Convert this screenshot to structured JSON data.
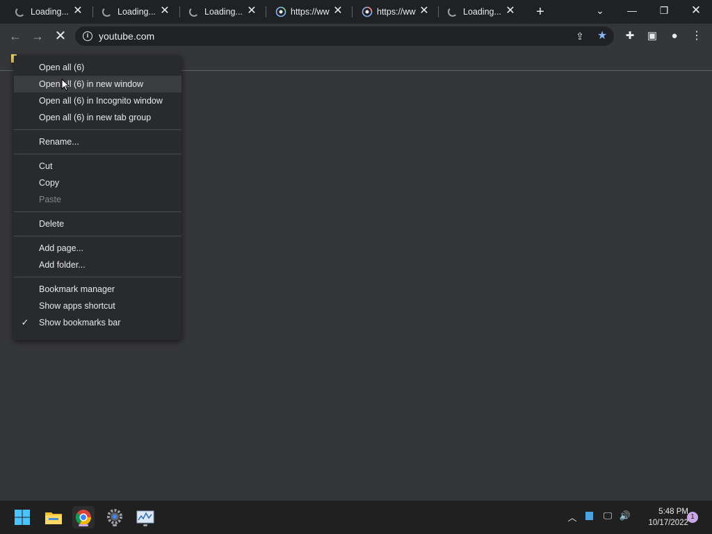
{
  "browser": {
    "tabs": [
      {
        "label": "Loading...",
        "kind": "spinner"
      },
      {
        "label": "Loading...",
        "kind": "spinner"
      },
      {
        "label": "Loading...",
        "kind": "spinner"
      },
      {
        "label": "https://www.google.com",
        "kind": "globe"
      },
      {
        "label": "https://www.google.com",
        "kind": "globe"
      },
      {
        "label": "Loading...",
        "kind": "spinner"
      }
    ],
    "new_tab_label": "+",
    "url": "youtube.com"
  },
  "context_menu": {
    "items": [
      {
        "label": "Open all (6)"
      },
      {
        "label": "Open all (6) in new window",
        "highlighted": true
      },
      {
        "label": "Open all (6) in Incognito window"
      },
      {
        "label": "Open all (6) in new tab group"
      },
      {
        "label": "Rename..."
      },
      {
        "label": "Cut"
      },
      {
        "label": "Copy"
      },
      {
        "label": "Paste",
        "disabled": true
      },
      {
        "label": "Delete"
      },
      {
        "label": "Add page..."
      },
      {
        "label": "Add folder..."
      },
      {
        "label": "Bookmark manager"
      },
      {
        "label": "Show apps shortcut"
      },
      {
        "label": "Show bookmarks bar",
        "checked": true
      }
    ]
  },
  "taskbar": {
    "time": "5:48 PM",
    "date": "10/17/2022",
    "notification_count": "1"
  },
  "colors": {
    "background": "#35363a",
    "titlebar": "#202124",
    "menu": "#292a2d",
    "accent_blue": "#8ab4f8",
    "folder_yellow": "#f4d469"
  }
}
